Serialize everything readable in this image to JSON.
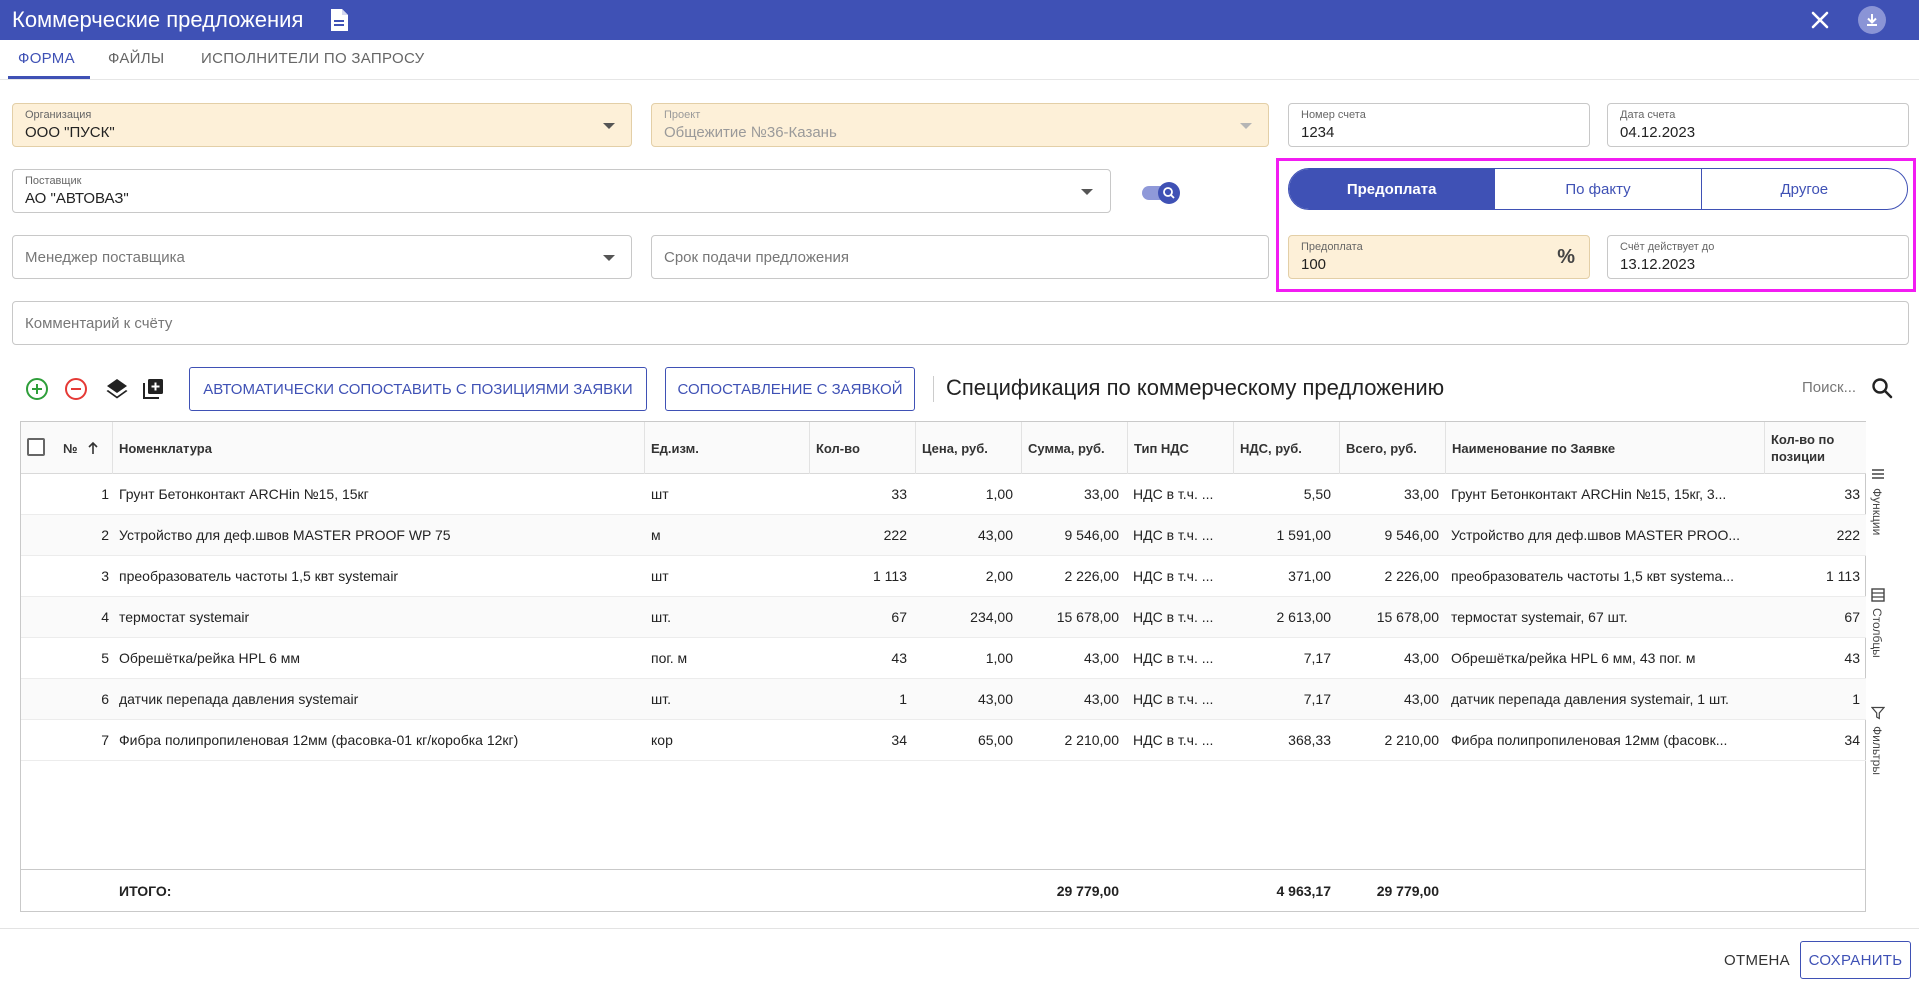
{
  "header": {
    "title": "Коммерческие предложения",
    "icons": [
      "document-icon",
      "close-icon",
      "download-icon"
    ]
  },
  "tabs": [
    {
      "label": "ФОРМА",
      "active": true
    },
    {
      "label": "ФАЙЛЫ",
      "active": false
    },
    {
      "label": "ИСПОЛНИТЕЛИ ПО ЗАПРОСУ",
      "active": false
    }
  ],
  "form": {
    "organization": {
      "label": "Организация",
      "value": "ООО \"ПУСК\""
    },
    "project": {
      "label": "Проект",
      "value": "Общежитие №36-Казань"
    },
    "invoice_number": {
      "label": "Номер счета",
      "value": "1234"
    },
    "invoice_date": {
      "label": "Дата счета",
      "value": "04.12.2023"
    },
    "supplier": {
      "label": "Поставщик",
      "value": "АО \"АВТОВАЗ\""
    },
    "supplier_manager": {
      "placeholder": "Менеджер поставщика"
    },
    "deadline": {
      "placeholder": "Срок подачи предложения"
    },
    "prepayment": {
      "label": "Предоплата",
      "value": "100"
    },
    "valid_until": {
      "label": "Счёт действует до",
      "value": "13.12.2023"
    },
    "comment": {
      "placeholder": "Комментарий к счёту"
    },
    "payment_types": [
      {
        "label": "Предоплата",
        "active": true
      },
      {
        "label": "По факту",
        "active": false
      },
      {
        "label": "Другое",
        "active": false
      }
    ]
  },
  "toolbar": {
    "auto_match_label": "АВТОМАТИЧЕСКИ СОПОСТАВИТЬ С ПОЗИЦИЯМИ ЗАЯВКИ",
    "match_label": "СОПОСТАВЛЕНИЕ С ЗАЯВКОЙ",
    "spec_title": "Спецификация по коммерческому предложению",
    "search_placeholder": "Поиск..."
  },
  "table": {
    "columns": {
      "num": "№",
      "nomenclature": "Номенклатура",
      "unit": "Ед.изм.",
      "qty": "Кол-во",
      "price": "Цена, руб.",
      "sum": "Сумма, руб.",
      "vat_type": "Тип НДС",
      "vat": "НДС, руб.",
      "total": "Всего, руб.",
      "request_name": "Наименование по Заявке",
      "qty_position": "Кол-во по позиции"
    },
    "rows": [
      {
        "num": "1",
        "name": "Грунт Бетонконтакт ARCHin №15, 15кг",
        "unit": "шт",
        "qty": "33",
        "price": "1,00",
        "sum": "33,00",
        "vat_type": "НДС в т.ч. ...",
        "vat": "5,50",
        "total": "33,00",
        "request_name": "Грунт Бетонконтакт ARCHin №15, 15кг, 3...",
        "qty_position": "33"
      },
      {
        "num": "2",
        "name": "Устройство для деф.швов MASTER PROOF WP 75",
        "unit": "м",
        "qty": "222",
        "price": "43,00",
        "sum": "9 546,00",
        "vat_type": "НДС в т.ч. ...",
        "vat": "1 591,00",
        "total": "9 546,00",
        "request_name": "Устройство для деф.швов MASTER PROO...",
        "qty_position": "222"
      },
      {
        "num": "3",
        "name": "преобразователь частоты 1,5 квт systemair",
        "unit": "шт",
        "qty": "1 113",
        "price": "2,00",
        "sum": "2 226,00",
        "vat_type": "НДС в т.ч. ...",
        "vat": "371,00",
        "total": "2 226,00",
        "request_name": "преобразователь частоты 1,5 квт systema...",
        "qty_position": "1 113"
      },
      {
        "num": "4",
        "name": "термостат systemair",
        "unit": "шт.",
        "qty": "67",
        "price": "234,00",
        "sum": "15 678,00",
        "vat_type": "НДС в т.ч. ...",
        "vat": "2 613,00",
        "total": "15 678,00",
        "request_name": "термостат systemair, 67 шт.",
        "qty_position": "67"
      },
      {
        "num": "5",
        "name": "Обрешётка/рейка HPL 6 мм",
        "unit": "пог. м",
        "qty": "43",
        "price": "1,00",
        "sum": "43,00",
        "vat_type": "НДС в т.ч. ...",
        "vat": "7,17",
        "total": "43,00",
        "request_name": "Обрешётка/рейка HPL 6 мм, 43 пог. м",
        "qty_position": "43"
      },
      {
        "num": "6",
        "name": "датчик перепада давления systemair",
        "unit": "шт.",
        "qty": "1",
        "price": "43,00",
        "sum": "43,00",
        "vat_type": "НДС в т.ч. ...",
        "vat": "7,17",
        "total": "43,00",
        "request_name": "датчик перепада давления systemair, 1 шт.",
        "qty_position": "1"
      },
      {
        "num": "7",
        "name": "Фибра полипропиленовая 12мм (фасовка-01 кг/коробка 12кг)",
        "unit": "кор",
        "qty": "34",
        "price": "65,00",
        "sum": "2 210,00",
        "vat_type": "НДС в т.ч. ...",
        "vat": "368,33",
        "total": "2 210,00",
        "request_name": "Фибра полипропиленовая 12мм (фасовк...",
        "qty_position": "34"
      }
    ],
    "totals": {
      "label": "ИТОГО:",
      "sum": "29 779,00",
      "vat": "4 963,17",
      "total": "29 779,00"
    },
    "side_tabs": [
      "Функции",
      "Столбцы",
      "Фильтры"
    ]
  },
  "footer": {
    "cancel_label": "ОТМЕНА",
    "save_label": "СОХРАНИТЬ"
  },
  "colors": {
    "primary": "#3f51b5",
    "highlight": "#f21cf2",
    "field_yellow": "#fdf0d8",
    "add_green": "#2e9e3a",
    "remove_red": "#e53935"
  }
}
